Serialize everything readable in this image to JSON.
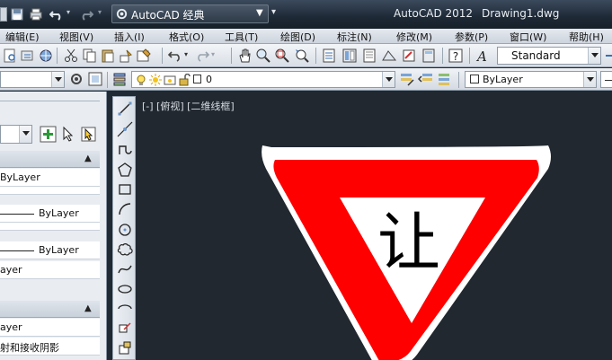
{
  "app": {
    "name": "AutoCAD 2012",
    "document": "Drawing1.dwg"
  },
  "workspace": {
    "selected": "AutoCAD 经典"
  },
  "menu": [
    "编辑(E)",
    "视图(V)",
    "插入(I)",
    "格式(O)",
    "工具(T)",
    "绘图(D)",
    "标注(N)",
    "修改(M)",
    "参数(P)",
    "窗口(W)",
    "帮助(H)"
  ],
  "styles": {
    "text_style": "Standard"
  },
  "layers": {
    "current": "0"
  },
  "properties": {
    "color": "ByLayer"
  },
  "palette": {
    "rows": [
      "ByLayer",
      "ByLayer",
      "ByLayer",
      "ayer",
      "ayer",
      "射和接收阴影"
    ]
  },
  "viewport": {
    "label": "[-] [俯视] [二维线框]"
  },
  "drawing": {
    "sign_text": "让",
    "sign_color": "#ff0000",
    "sign_border": "#ffffff"
  }
}
